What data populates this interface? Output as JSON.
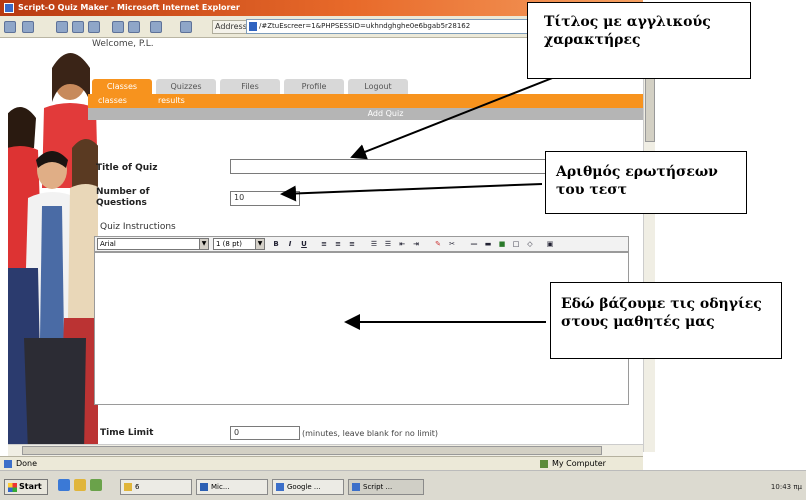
{
  "window": {
    "title": "Script-O Quiz Maker - Microsoft Internet Explorer",
    "address_label": "Address",
    "url": "/#ZtuEscreer=1&PHPSESSID=ukhndghghe0e6bgab5r28162",
    "go": "▼"
  },
  "page": {
    "welcome": "Welcome, P.L.",
    "tabs": [
      "Classes",
      "Quizzes",
      "Files",
      "Profile",
      "Logout"
    ],
    "subnav": [
      "classes",
      "results"
    ],
    "section_title": "Add Quiz"
  },
  "form": {
    "title_label": "Title of Quiz",
    "title_value": "",
    "num_questions_label_1": "Number of",
    "num_questions_label_2": "Questions",
    "num_questions_value": "10",
    "instructions_label": "Quiz Instructions",
    "font_select": "Arial",
    "size_select": "1 (8 pt)",
    "time_limit_label": "Time Limit",
    "time_limit_value": "0",
    "time_limit_hint": "(minutes, leave blank for no limit)"
  },
  "editor_buttons": [
    "B",
    "I",
    "U",
    "≡",
    "≡",
    "≡",
    "☰",
    "☰",
    "⇤",
    "⇥",
    "✎",
    "✂",
    "—",
    "▬",
    "■",
    "□",
    "◇",
    "▣"
  ],
  "status": {
    "text": "Done",
    "zone": "My Computer"
  },
  "taskbar": {
    "start": "Start",
    "tasks": [
      "6",
      "Mic...",
      "Google ...",
      "Script ..."
    ],
    "clock": "10:43 πμ"
  },
  "callouts": {
    "title": "Τίτλος με αγγλικούς χαρακτήρες",
    "questions": "Αριθμός ερωτήσεων του τεστ",
    "instructions": "Εδώ βάζουμε τις οδηγίες στους μαθητές μας"
  },
  "colors": {
    "accent": "#f7931e",
    "titlebar": "#d35a1e",
    "section_bar": "#b5b5b5"
  }
}
